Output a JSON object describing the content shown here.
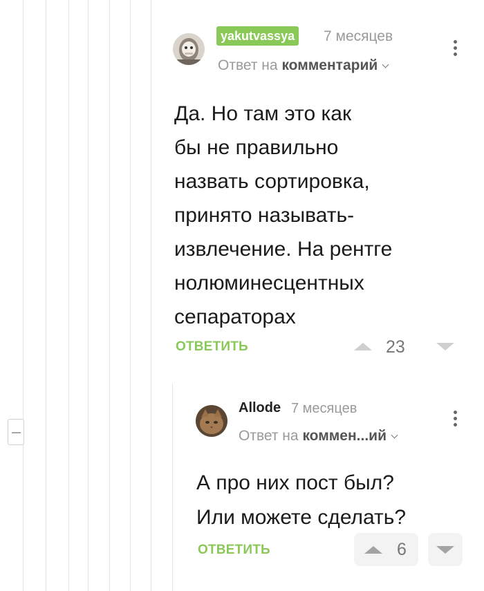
{
  "comments": [
    {
      "username": "yakutvassya",
      "time": "7 месяцев",
      "reply_prefix": "Ответ на",
      "reply_target": "комментарий",
      "text": "Да. Но там это как\nбы не правильно\nназвать сортировка,\nпринято называть-\nизвлечение. На рентге\nнолюминесцентных\nсепараторах",
      "reply_label": "ОТВЕТИТЬ",
      "rating": "23"
    },
    {
      "username": "Allode",
      "time": "7 месяцев",
      "reply_prefix": "Ответ на",
      "reply_target": "коммен...ий",
      "text": "А про них пост был?\nИли можете сделать?",
      "reply_label": "ОТВЕТИТЬ",
      "rating": "6"
    }
  ],
  "colors": {
    "accent_green": "#8ac858",
    "muted_gray": "#9a9a9a"
  },
  "icons": [
    "kebab-menu-icon",
    "chevron-down-icon",
    "upvote-icon",
    "downvote-icon",
    "collapse-icon"
  ]
}
